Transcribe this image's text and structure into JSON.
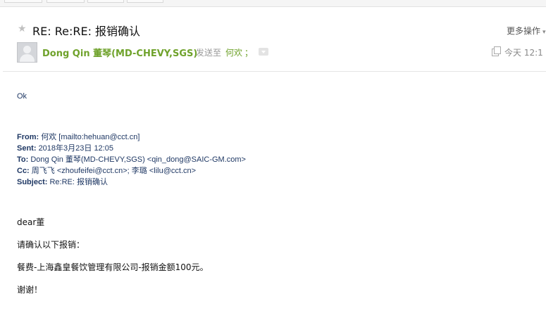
{
  "email": {
    "subject": "RE: Re:RE: 报销确认",
    "more_actions_label": "更多操作",
    "sender": "Dong Qin 董琴(MD-CHEVY,SGS)",
    "sent_to_label": "发送至",
    "recipient": "何欢",
    "recipient_sep": "；",
    "time": "今天 12:1"
  },
  "icons": {
    "star": "star-icon",
    "avatar": "avatar-icon",
    "expand": "chevron-down-icon",
    "copy": "copy-icon",
    "more_caret": "chevron-down-icon"
  },
  "body": {
    "reply": "Ok",
    "quoted": {
      "from_label": "From:",
      "from_value": "何欢 [mailto:hehuan@cct.cn]",
      "sent_label": "Sent:",
      "sent_value": "2018年3月23日 12:05",
      "to_label": "To:",
      "to_value": "Dong Qin 董琴(MD-CHEVY,SGS) <qin_dong@SAIC-GM.com>",
      "cc_label": "Cc:",
      "cc_value": "周飞飞 <zhoufeifei@cct.cn>; 李璐 <lilu@cct.cn>",
      "subject_label": "Subject:",
      "subject_value": "Re:RE: 报销确认"
    },
    "greeting": "dear董",
    "line1": "请确认以下报销：",
    "line2": "餐费-上海鑫皇餐饮管理有限公司-报销金额100元。",
    "closing": "谢谢！"
  }
}
